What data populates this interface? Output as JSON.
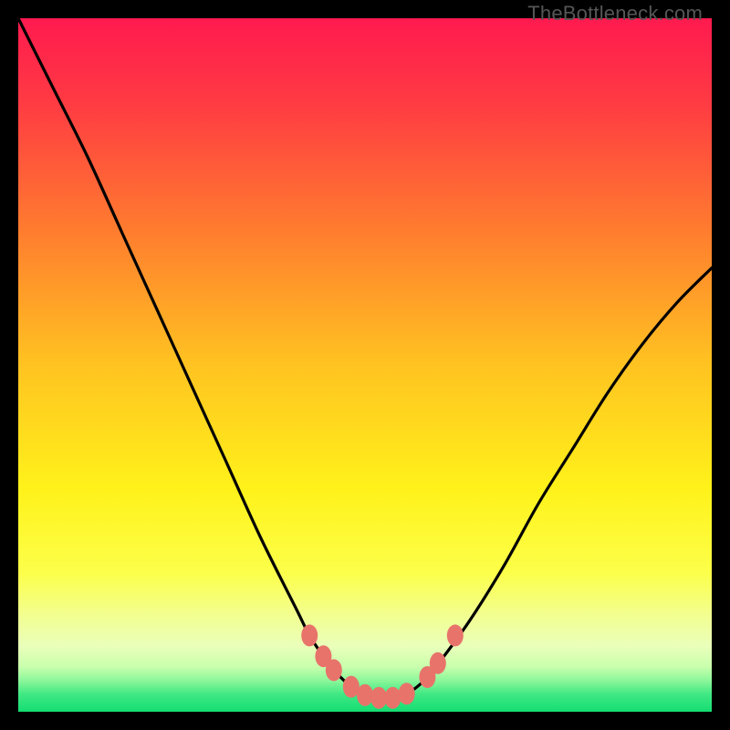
{
  "watermark": "TheBottleneck.com",
  "chart_data": {
    "type": "line",
    "title": "",
    "xlabel": "",
    "ylabel": "",
    "xlim": [
      0,
      100
    ],
    "ylim": [
      0,
      100
    ],
    "series": [
      {
        "name": "curve",
        "x": [
          0,
          5,
          10,
          15,
          20,
          25,
          30,
          35,
          40,
          42,
          44,
          46,
          48,
          50,
          52,
          54,
          56,
          58,
          60,
          65,
          70,
          75,
          80,
          85,
          90,
          95,
          100
        ],
        "y": [
          100,
          90,
          80,
          69,
          58,
          47,
          36,
          25,
          15,
          11,
          8,
          5.5,
          3.6,
          2.4,
          2.0,
          2.0,
          2.6,
          4.0,
          6.2,
          13,
          21,
          30,
          38,
          46,
          53,
          59,
          64
        ]
      }
    ],
    "markers": {
      "name": "highlight-dots",
      "color": "#e8736b",
      "points": [
        {
          "x": 42.0,
          "y": 11.0
        },
        {
          "x": 44.0,
          "y": 8.0
        },
        {
          "x": 45.5,
          "y": 6.0
        },
        {
          "x": 48.0,
          "y": 3.6
        },
        {
          "x": 50.0,
          "y": 2.4
        },
        {
          "x": 52.0,
          "y": 2.0
        },
        {
          "x": 54.0,
          "y": 2.0
        },
        {
          "x": 56.0,
          "y": 2.6
        },
        {
          "x": 59.0,
          "y": 5.0
        },
        {
          "x": 60.5,
          "y": 7.0
        },
        {
          "x": 63.0,
          "y": 11.0
        }
      ]
    },
    "gradient_stops": [
      {
        "offset": 0.0,
        "color": "#ff1a4f"
      },
      {
        "offset": 0.12,
        "color": "#ff3a43"
      },
      {
        "offset": 0.3,
        "color": "#ff7a2f"
      },
      {
        "offset": 0.5,
        "color": "#ffc321"
      },
      {
        "offset": 0.68,
        "color": "#fff21a"
      },
      {
        "offset": 0.8,
        "color": "#fcff4a"
      },
      {
        "offset": 0.86,
        "color": "#f2ff8f"
      },
      {
        "offset": 0.905,
        "color": "#eaffba"
      },
      {
        "offset": 0.935,
        "color": "#c9ffad"
      },
      {
        "offset": 0.955,
        "color": "#8cf79a"
      },
      {
        "offset": 0.975,
        "color": "#40e883"
      },
      {
        "offset": 1.0,
        "color": "#14dd72"
      }
    ]
  }
}
